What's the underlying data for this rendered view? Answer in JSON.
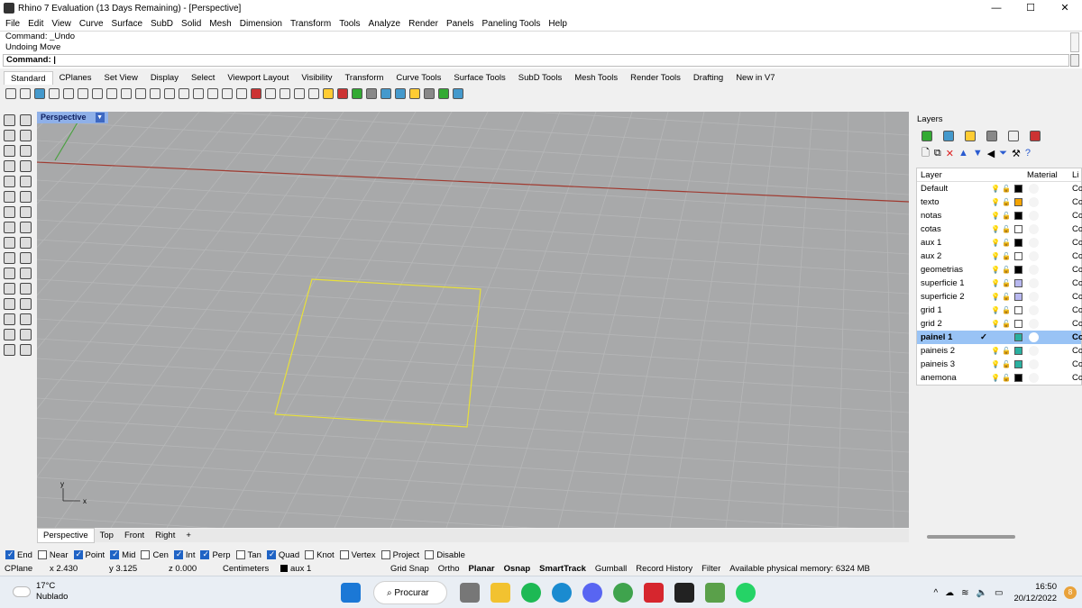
{
  "window": {
    "title": "Rhino 7 Evaluation (13 Days Remaining) - [Perspective]",
    "minimize": "—",
    "maximize": "☐",
    "close": "✕"
  },
  "menu": [
    "File",
    "Edit",
    "View",
    "Curve",
    "Surface",
    "SubD",
    "Solid",
    "Mesh",
    "Dimension",
    "Transform",
    "Tools",
    "Analyze",
    "Render",
    "Panels",
    "Paneling Tools",
    "Help"
  ],
  "command": {
    "history": [
      "Command: _Undo",
      "Undoing Move"
    ],
    "prompt": "Command:"
  },
  "toolbar_tabs": [
    "Standard",
    "CPlanes",
    "Set View",
    "Display",
    "Select",
    "Viewport Layout",
    "Visibility",
    "Transform",
    "Curve Tools",
    "Surface Tools",
    "SubD Tools",
    "Mesh Tools",
    "Render Tools",
    "Drafting",
    "New in V7"
  ],
  "viewport": {
    "title": "Perspective",
    "axis_y": "y",
    "axis_x": "x"
  },
  "view_tabs": [
    "Perspective",
    "Top",
    "Front",
    "Right",
    "+"
  ],
  "layers": {
    "title": "Layers",
    "col_layer": "Layer",
    "col_material": "Material",
    "col_linetype": "Li",
    "rows": [
      {
        "name": "Default",
        "color": "#000000",
        "li": "Co"
      },
      {
        "name": "texto",
        "color": "#f5a400",
        "li": "Co"
      },
      {
        "name": "notas",
        "color": "#000000",
        "li": "Co"
      },
      {
        "name": "cotas",
        "color": "#ffffff",
        "li": "Co"
      },
      {
        "name": "aux 1",
        "color": "#000000",
        "li": "Co"
      },
      {
        "name": "aux 2",
        "color": "#ffffff",
        "li": "Co"
      },
      {
        "name": "geometrias",
        "color": "#000000",
        "li": "Co"
      },
      {
        "name": "superficie 1",
        "color": "#b8b8f0",
        "li": "Co"
      },
      {
        "name": "superficie 2",
        "color": "#b8b8f0",
        "li": "Co"
      },
      {
        "name": "grid 1",
        "color": "#ffffff",
        "li": "Co"
      },
      {
        "name": "grid 2",
        "color": "#ffffff",
        "li": "Co"
      },
      {
        "name": "painel 1",
        "color": "#2ab0a0",
        "li": "Co",
        "selected": true,
        "check": "✓"
      },
      {
        "name": "paineis 2",
        "color": "#2ab0a0",
        "li": "Co"
      },
      {
        "name": "paineis 3",
        "color": "#2ab0a0",
        "li": "Co"
      },
      {
        "name": "anemona",
        "color": "#000000",
        "li": "Co"
      }
    ]
  },
  "osnap": [
    {
      "label": "End",
      "on": true
    },
    {
      "label": "Near",
      "on": false
    },
    {
      "label": "Point",
      "on": true
    },
    {
      "label": "Mid",
      "on": true
    },
    {
      "label": "Cen",
      "on": false
    },
    {
      "label": "Int",
      "on": true
    },
    {
      "label": "Perp",
      "on": true
    },
    {
      "label": "Tan",
      "on": false
    },
    {
      "label": "Quad",
      "on": true
    },
    {
      "label": "Knot",
      "on": false
    },
    {
      "label": "Vertex",
      "on": false
    },
    {
      "label": "Project",
      "on": false
    },
    {
      "label": "Disable",
      "on": false
    }
  ],
  "status": {
    "cplane": "CPlane",
    "x": "x 2.430",
    "y": "y 3.125",
    "z": "z 0.000",
    "units": "Centimeters",
    "layer": "aux 1",
    "grid_snap": "Grid Snap",
    "ortho": "Ortho",
    "planar": "Planar",
    "osnap": "Osnap",
    "smarttrack": "SmartTrack",
    "gumball": "Gumball",
    "record_history": "Record History",
    "filter": "Filter",
    "memory": "Available physical memory: 6324 MB"
  },
  "taskbar": {
    "temperature": "17°C",
    "weather": "Nublado",
    "search": "Procurar",
    "time": "16:50",
    "date": "20/12/2022",
    "notifications": "8"
  },
  "colors": {
    "viewport_bg": "#a8a9aa",
    "grid_line": "#b6b7b8",
    "axis_x": "#a03a30",
    "axis_y": "#4aa040",
    "selection": "#e8e03a",
    "accent": "#1f63c5"
  }
}
